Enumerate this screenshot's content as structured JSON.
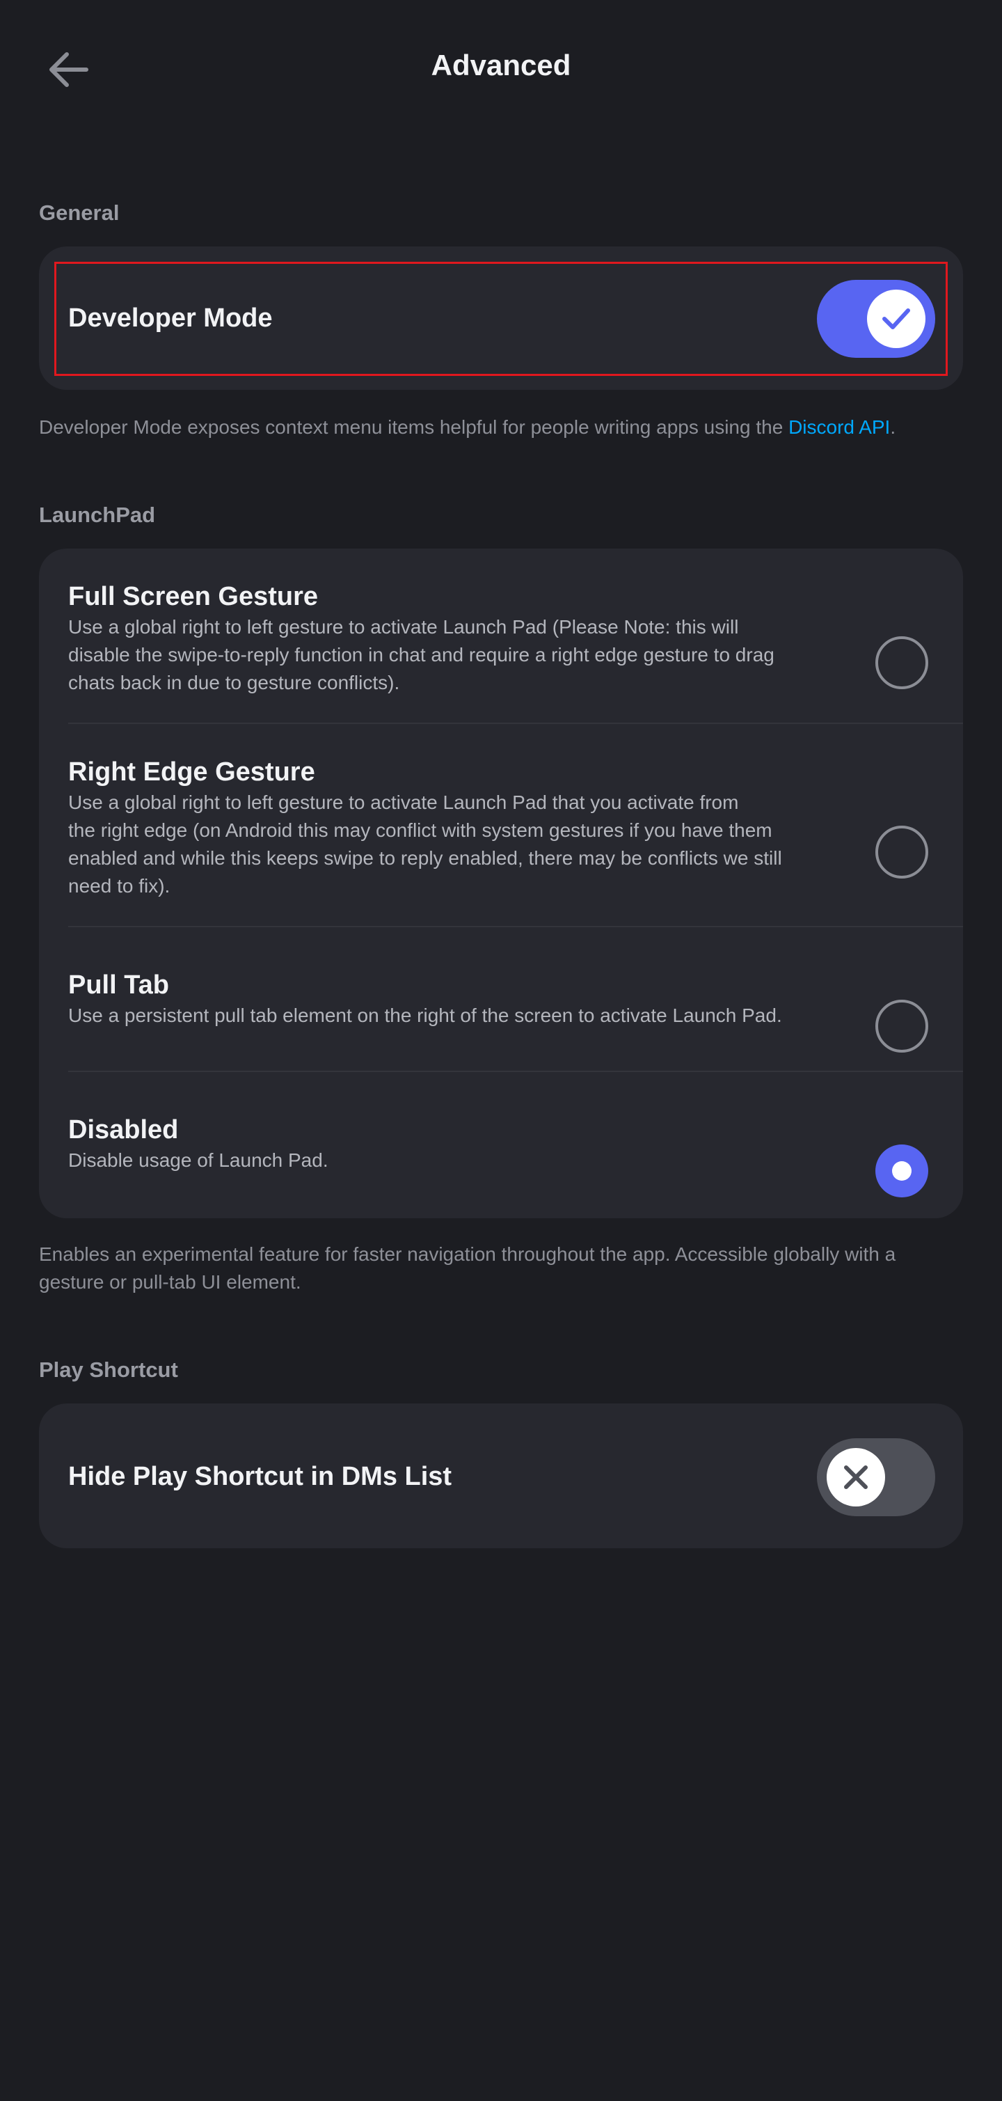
{
  "header": {
    "title": "Advanced",
    "back_icon": "arrow-left-icon"
  },
  "general": {
    "section_label": "General",
    "developer_mode": {
      "label": "Developer Mode",
      "enabled": true,
      "icon": "check-icon"
    },
    "footnote_text": "Developer Mode exposes context menu items helpful for people writing apps using the ",
    "footnote_link": "Discord API",
    "footnote_end": "."
  },
  "launchpad": {
    "section_label": "LaunchPad",
    "options": [
      {
        "title": "Full Screen Gesture",
        "lines": [
          "Use a global right to left gesture to activate Launch Pad (Please Note: this will",
          "disable the swipe-to-reply function in chat and require a right edge gesture to drag",
          "chats back in due to gesture conflicts)."
        ],
        "selected": false
      },
      {
        "title": "Right Edge Gesture",
        "lines": [
          "Use a global right to left gesture to activate Launch Pad that you activate from",
          "the right edge (on Android this may conflict with system gestures if you have them",
          "enabled and while this keeps swipe to reply enabled, there may be conflicts we still",
          "need to fix)."
        ],
        "selected": false
      },
      {
        "title": "Pull Tab",
        "lines": [
          "Use a persistent pull tab element on the right of the screen to activate Launch Pad."
        ],
        "selected": false
      },
      {
        "title": "Disabled",
        "lines": [
          "Disable usage of Launch Pad."
        ],
        "selected": true
      }
    ],
    "footnote_lines": [
      "Enables an experimental feature for faster navigation throughout the app. Accessible globally with a",
      "gesture or pull-tab UI element."
    ]
  },
  "play_shortcut": {
    "section_label": "Play Shortcut",
    "hide_play_shortcut": {
      "label": "Hide Play Shortcut in DMs List",
      "enabled": false,
      "icon": "close-icon"
    }
  },
  "colors": {
    "background": "#1c1d22",
    "card": "#27282f",
    "accent": "#5865f2",
    "link": "#00a8fc",
    "toggle_off": "#4e5058",
    "highlight": "#e0181e"
  }
}
